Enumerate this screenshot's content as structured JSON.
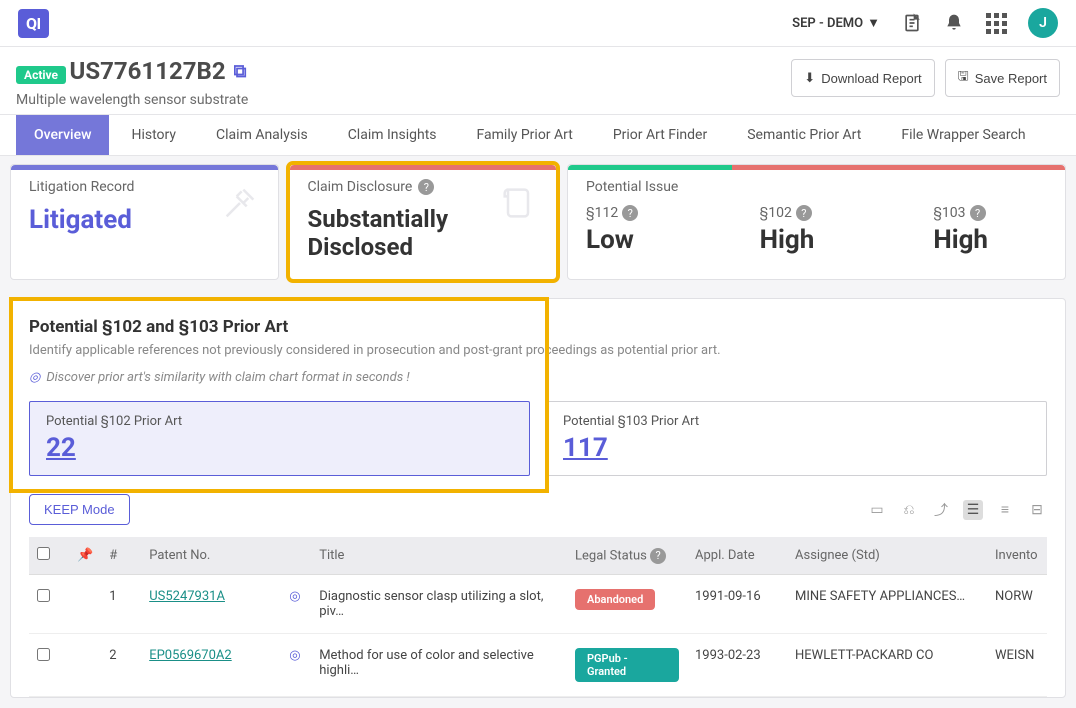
{
  "topbar": {
    "logo": "QI",
    "workspace": "SEP - DEMO",
    "avatar": "J"
  },
  "title": {
    "badge": "Active",
    "patent": "US7761127B2",
    "subtitle": "Multiple wavelength sensor substrate",
    "download": "Download Report",
    "save": "Save Report"
  },
  "tabs": [
    "Overview",
    "History",
    "Claim Analysis",
    "Claim Insights",
    "Family Prior Art",
    "Prior Art Finder",
    "Semantic Prior Art",
    "File Wrapper Search"
  ],
  "cards": {
    "litigation": {
      "label": "Litigation Record",
      "value": "Litigated"
    },
    "disclosure": {
      "label": "Claim Disclosure",
      "value": "Substantially Disclosed"
    },
    "issue": {
      "label": "Potential Issue",
      "cols": [
        {
          "sec": "§112",
          "val": "Low"
        },
        {
          "sec": "§102",
          "val": "High"
        },
        {
          "sec": "§103",
          "val": "High"
        }
      ]
    }
  },
  "section": {
    "heading": "Potential §102 and §103 Prior Art",
    "sub": "Identify applicable references not previously considered in prosecution and post-grant proceedings as potential prior art.",
    "discover": "Discover prior art's similarity with claim chart format in seconds  !",
    "box102": {
      "label": "Potential §102 Prior Art",
      "count": "22"
    },
    "box103": {
      "label": "Potential §103 Prior Art",
      "count": "117"
    },
    "keep": "KEEP Mode"
  },
  "table": {
    "headers": {
      "num": "#",
      "patent": "Patent No.",
      "title": "Title",
      "status": "Legal Status",
      "appl": "Appl. Date",
      "assignee": "Assignee (Std)",
      "inventor": "Invento"
    },
    "rows": [
      {
        "num": "1",
        "patent": "US5247931A",
        "title": "Diagnostic sensor clasp utilizing a slot, piv…",
        "status": "Abandoned",
        "statusClass": "st-abandoned",
        "appl": "1991-09-16",
        "assignee": "MINE SAFETY APPLIANCES…",
        "inventor": "NORW"
      },
      {
        "num": "2",
        "patent": "EP0569670A2",
        "title": "Method for use of color and selective highli…",
        "status": "PGPub - Granted",
        "statusClass": "st-granted",
        "appl": "1993-02-23",
        "assignee": "HEWLETT-PACKARD CO",
        "inventor": "WEISN"
      }
    ]
  }
}
